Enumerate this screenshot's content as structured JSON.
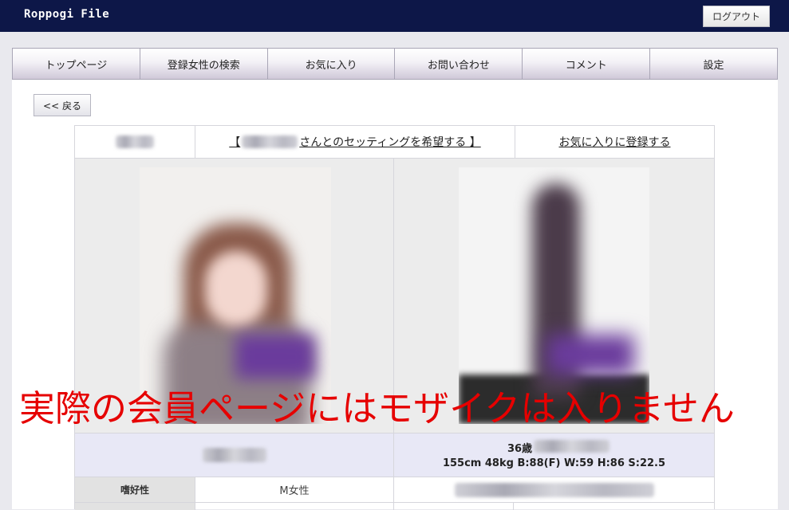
{
  "header": {
    "brand": "Roppogi File",
    "logout_label": "ログアウト"
  },
  "nav": {
    "items": [
      {
        "label": "トップページ"
      },
      {
        "label": "登録女性の検索"
      },
      {
        "label": "お気に入り"
      },
      {
        "label": "お問い合わせ"
      },
      {
        "label": "コメント"
      },
      {
        "label": "設定"
      }
    ]
  },
  "back_label": "<< 戻る",
  "profile": {
    "setting_open": "【",
    "setting_text": "さんとのセッティングを希望する 】",
    "favorite_label": "お気に入りに登録する",
    "age": "36歳",
    "measurements": "155cm  48kg  B:88(F) W:59 H:86 S:22.5",
    "preference_label": "嗜好性",
    "preference_value": "M女性"
  },
  "notice": "実際の会員ページにはモザイクは入りません",
  "colors": {
    "header_bg": "#0d1748",
    "notice": "#e60000",
    "info_row_bg": "#e8e8f6"
  }
}
